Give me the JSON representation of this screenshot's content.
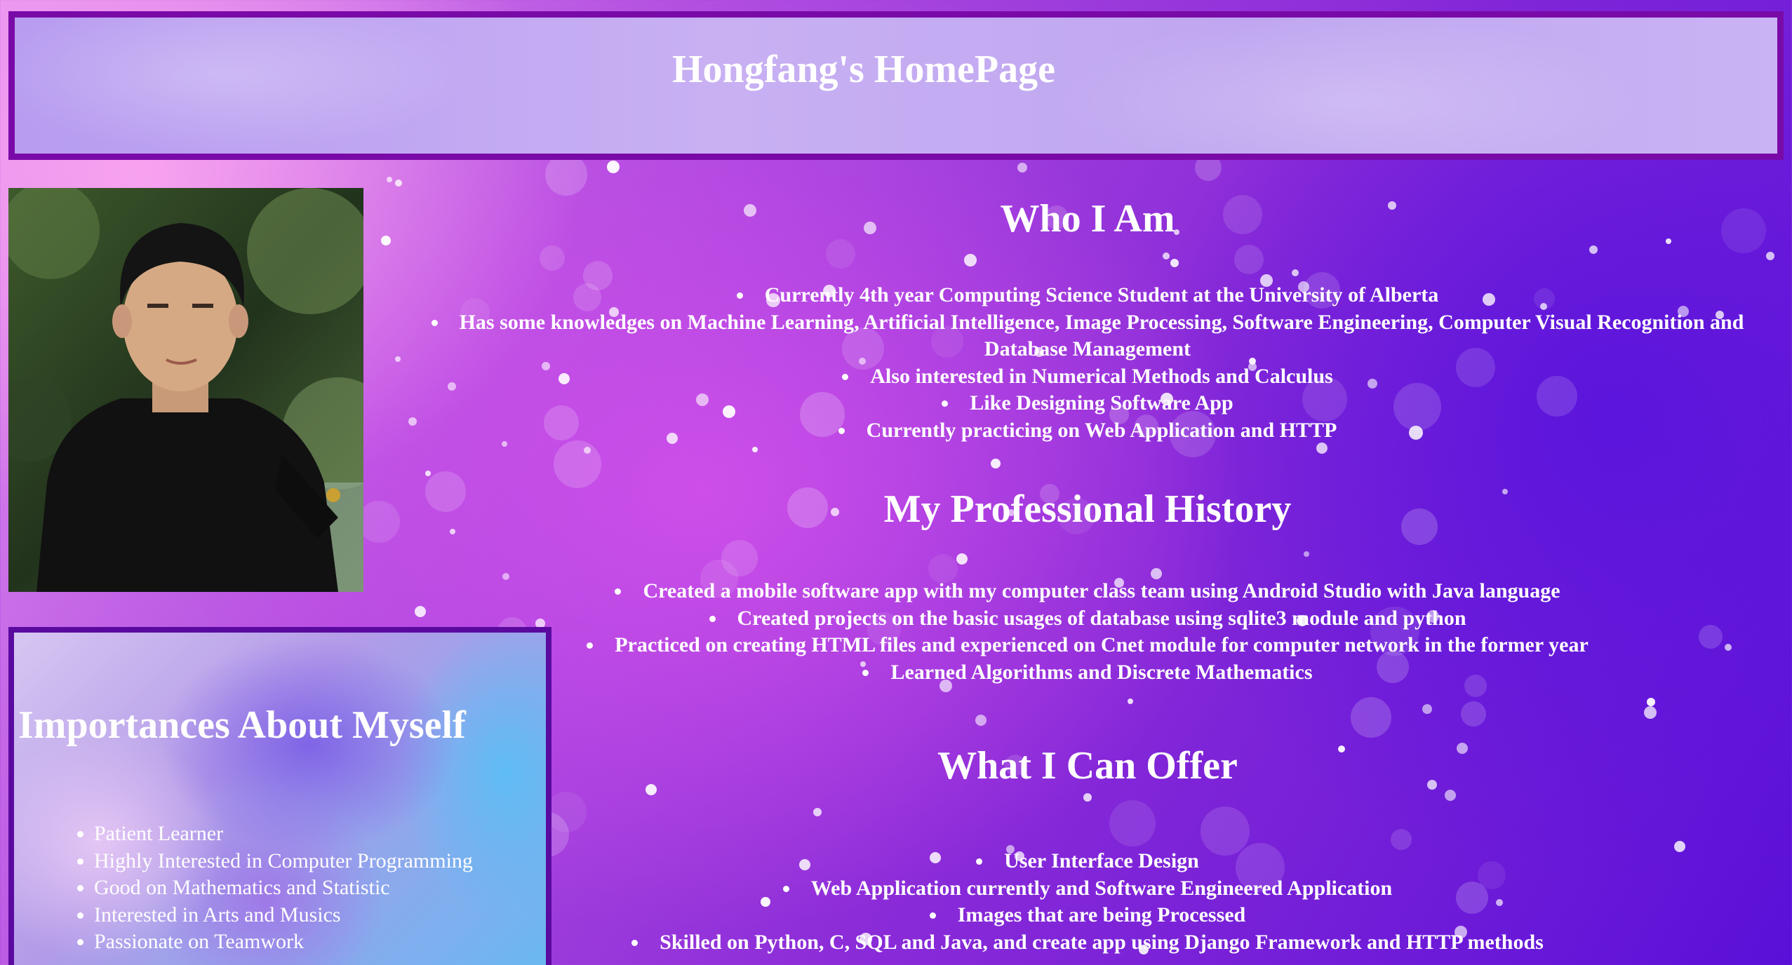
{
  "header": {
    "title": "Hongfang's HomePage"
  },
  "who_i_am": {
    "heading": "Who I Am",
    "items": [
      "Currently 4th year Computing Science Student at the University of Alberta",
      "Has some knowledges on Machine Learning, Artificial Intelligence, Image Processing, Software Engineering, Computer Visual Recognition and Database Management",
      "Also interested in Numerical Methods and Calculus",
      "Like Designing Software App",
      "Currently practicing on Web Application and HTTP"
    ]
  },
  "professional_history": {
    "heading": "My Professional History",
    "items": [
      "Created a mobile software app with my computer class team using Android Studio with Java language",
      "Created projects on the basic usages of database using sqlite3 module and python",
      "Practiced on creating HTML files and experienced on Cnet module for computer network in the former year",
      "Learned Algorithms and Discrete Mathematics"
    ]
  },
  "what_i_can_offer": {
    "heading": "What I Can Offer",
    "items": [
      "User Interface Design",
      "Web Application currently and Software Engineered Application",
      "Images that are being Processed",
      "Skilled on Python, C, SQL and Java, and create app using Django Framework and HTTP methods"
    ]
  },
  "importances": {
    "heading": "Importances About Myself",
    "items": [
      "Patient Learner",
      "Highly Interested in Computer Programming",
      "Good on Mathematics and Statistic",
      "Interested in Arts and Musics",
      "Passionate on Teamwork"
    ]
  },
  "colors": {
    "header_border": "#7a0aa8",
    "importances_border": "#5b0aa0",
    "text": "#ffffff"
  }
}
